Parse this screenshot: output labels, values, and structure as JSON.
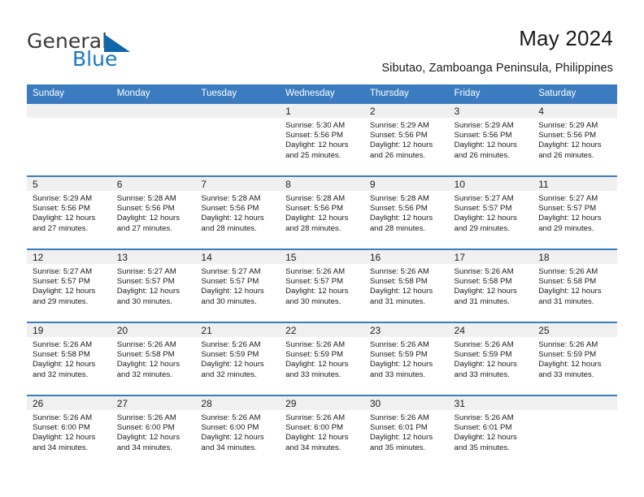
{
  "brand": {
    "name_top": "General",
    "name_bottom": "Blue",
    "triangle_icon": "blue-triangle-logo-mark",
    "accent_color": "#1879bf"
  },
  "header": {
    "title": "May 2024",
    "subtitle": "Sibutao, Zamboanga Peninsula, Philippines"
  },
  "colors": {
    "header_row_bg": "#3a7cbf",
    "day_number_bg": "#f0f0f0",
    "row_divider": "#3a7cbf",
    "text": "#1a1a1a"
  },
  "weekdays": [
    "Sunday",
    "Monday",
    "Tuesday",
    "Wednesday",
    "Thursday",
    "Friday",
    "Saturday"
  ],
  "weeks": [
    [
      {
        "day": "",
        "sunrise": "",
        "sunset": "",
        "daylight_line1": "",
        "daylight_line2": ""
      },
      {
        "day": "",
        "sunrise": "",
        "sunset": "",
        "daylight_line1": "",
        "daylight_line2": ""
      },
      {
        "day": "",
        "sunrise": "",
        "sunset": "",
        "daylight_line1": "",
        "daylight_line2": ""
      },
      {
        "day": "1",
        "sunrise": "Sunrise: 5:30 AM",
        "sunset": "Sunset: 5:56 PM",
        "daylight_line1": "Daylight: 12 hours",
        "daylight_line2": "and 25 minutes."
      },
      {
        "day": "2",
        "sunrise": "Sunrise: 5:29 AM",
        "sunset": "Sunset: 5:56 PM",
        "daylight_line1": "Daylight: 12 hours",
        "daylight_line2": "and 26 minutes."
      },
      {
        "day": "3",
        "sunrise": "Sunrise: 5:29 AM",
        "sunset": "Sunset: 5:56 PM",
        "daylight_line1": "Daylight: 12 hours",
        "daylight_line2": "and 26 minutes."
      },
      {
        "day": "4",
        "sunrise": "Sunrise: 5:29 AM",
        "sunset": "Sunset: 5:56 PM",
        "daylight_line1": "Daylight: 12 hours",
        "daylight_line2": "and 26 minutes."
      }
    ],
    [
      {
        "day": "5",
        "sunrise": "Sunrise: 5:29 AM",
        "sunset": "Sunset: 5:56 PM",
        "daylight_line1": "Daylight: 12 hours",
        "daylight_line2": "and 27 minutes."
      },
      {
        "day": "6",
        "sunrise": "Sunrise: 5:28 AM",
        "sunset": "Sunset: 5:56 PM",
        "daylight_line1": "Daylight: 12 hours",
        "daylight_line2": "and 27 minutes."
      },
      {
        "day": "7",
        "sunrise": "Sunrise: 5:28 AM",
        "sunset": "Sunset: 5:56 PM",
        "daylight_line1": "Daylight: 12 hours",
        "daylight_line2": "and 28 minutes."
      },
      {
        "day": "8",
        "sunrise": "Sunrise: 5:28 AM",
        "sunset": "Sunset: 5:56 PM",
        "daylight_line1": "Daylight: 12 hours",
        "daylight_line2": "and 28 minutes."
      },
      {
        "day": "9",
        "sunrise": "Sunrise: 5:28 AM",
        "sunset": "Sunset: 5:56 PM",
        "daylight_line1": "Daylight: 12 hours",
        "daylight_line2": "and 28 minutes."
      },
      {
        "day": "10",
        "sunrise": "Sunrise: 5:27 AM",
        "sunset": "Sunset: 5:57 PM",
        "daylight_line1": "Daylight: 12 hours",
        "daylight_line2": "and 29 minutes."
      },
      {
        "day": "11",
        "sunrise": "Sunrise: 5:27 AM",
        "sunset": "Sunset: 5:57 PM",
        "daylight_line1": "Daylight: 12 hours",
        "daylight_line2": "and 29 minutes."
      }
    ],
    [
      {
        "day": "12",
        "sunrise": "Sunrise: 5:27 AM",
        "sunset": "Sunset: 5:57 PM",
        "daylight_line1": "Daylight: 12 hours",
        "daylight_line2": "and 29 minutes."
      },
      {
        "day": "13",
        "sunrise": "Sunrise: 5:27 AM",
        "sunset": "Sunset: 5:57 PM",
        "daylight_line1": "Daylight: 12 hours",
        "daylight_line2": "and 30 minutes."
      },
      {
        "day": "14",
        "sunrise": "Sunrise: 5:27 AM",
        "sunset": "Sunset: 5:57 PM",
        "daylight_line1": "Daylight: 12 hours",
        "daylight_line2": "and 30 minutes."
      },
      {
        "day": "15",
        "sunrise": "Sunrise: 5:26 AM",
        "sunset": "Sunset: 5:57 PM",
        "daylight_line1": "Daylight: 12 hours",
        "daylight_line2": "and 30 minutes."
      },
      {
        "day": "16",
        "sunrise": "Sunrise: 5:26 AM",
        "sunset": "Sunset: 5:58 PM",
        "daylight_line1": "Daylight: 12 hours",
        "daylight_line2": "and 31 minutes."
      },
      {
        "day": "17",
        "sunrise": "Sunrise: 5:26 AM",
        "sunset": "Sunset: 5:58 PM",
        "daylight_line1": "Daylight: 12 hours",
        "daylight_line2": "and 31 minutes."
      },
      {
        "day": "18",
        "sunrise": "Sunrise: 5:26 AM",
        "sunset": "Sunset: 5:58 PM",
        "daylight_line1": "Daylight: 12 hours",
        "daylight_line2": "and 31 minutes."
      }
    ],
    [
      {
        "day": "19",
        "sunrise": "Sunrise: 5:26 AM",
        "sunset": "Sunset: 5:58 PM",
        "daylight_line1": "Daylight: 12 hours",
        "daylight_line2": "and 32 minutes."
      },
      {
        "day": "20",
        "sunrise": "Sunrise: 5:26 AM",
        "sunset": "Sunset: 5:58 PM",
        "daylight_line1": "Daylight: 12 hours",
        "daylight_line2": "and 32 minutes."
      },
      {
        "day": "21",
        "sunrise": "Sunrise: 5:26 AM",
        "sunset": "Sunset: 5:59 PM",
        "daylight_line1": "Daylight: 12 hours",
        "daylight_line2": "and 32 minutes."
      },
      {
        "day": "22",
        "sunrise": "Sunrise: 5:26 AM",
        "sunset": "Sunset: 5:59 PM",
        "daylight_line1": "Daylight: 12 hours",
        "daylight_line2": "and 33 minutes."
      },
      {
        "day": "23",
        "sunrise": "Sunrise: 5:26 AM",
        "sunset": "Sunset: 5:59 PM",
        "daylight_line1": "Daylight: 12 hours",
        "daylight_line2": "and 33 minutes."
      },
      {
        "day": "24",
        "sunrise": "Sunrise: 5:26 AM",
        "sunset": "Sunset: 5:59 PM",
        "daylight_line1": "Daylight: 12 hours",
        "daylight_line2": "and 33 minutes."
      },
      {
        "day": "25",
        "sunrise": "Sunrise: 5:26 AM",
        "sunset": "Sunset: 5:59 PM",
        "daylight_line1": "Daylight: 12 hours",
        "daylight_line2": "and 33 minutes."
      }
    ],
    [
      {
        "day": "26",
        "sunrise": "Sunrise: 5:26 AM",
        "sunset": "Sunset: 6:00 PM",
        "daylight_line1": "Daylight: 12 hours",
        "daylight_line2": "and 34 minutes."
      },
      {
        "day": "27",
        "sunrise": "Sunrise: 5:26 AM",
        "sunset": "Sunset: 6:00 PM",
        "daylight_line1": "Daylight: 12 hours",
        "daylight_line2": "and 34 minutes."
      },
      {
        "day": "28",
        "sunrise": "Sunrise: 5:26 AM",
        "sunset": "Sunset: 6:00 PM",
        "daylight_line1": "Daylight: 12 hours",
        "daylight_line2": "and 34 minutes."
      },
      {
        "day": "29",
        "sunrise": "Sunrise: 5:26 AM",
        "sunset": "Sunset: 6:00 PM",
        "daylight_line1": "Daylight: 12 hours",
        "daylight_line2": "and 34 minutes."
      },
      {
        "day": "30",
        "sunrise": "Sunrise: 5:26 AM",
        "sunset": "Sunset: 6:01 PM",
        "daylight_line1": "Daylight: 12 hours",
        "daylight_line2": "and 35 minutes."
      },
      {
        "day": "31",
        "sunrise": "Sunrise: 5:26 AM",
        "sunset": "Sunset: 6:01 PM",
        "daylight_line1": "Daylight: 12 hours",
        "daylight_line2": "and 35 minutes."
      },
      {
        "day": "",
        "sunrise": "",
        "sunset": "",
        "daylight_line1": "",
        "daylight_line2": ""
      }
    ]
  ]
}
